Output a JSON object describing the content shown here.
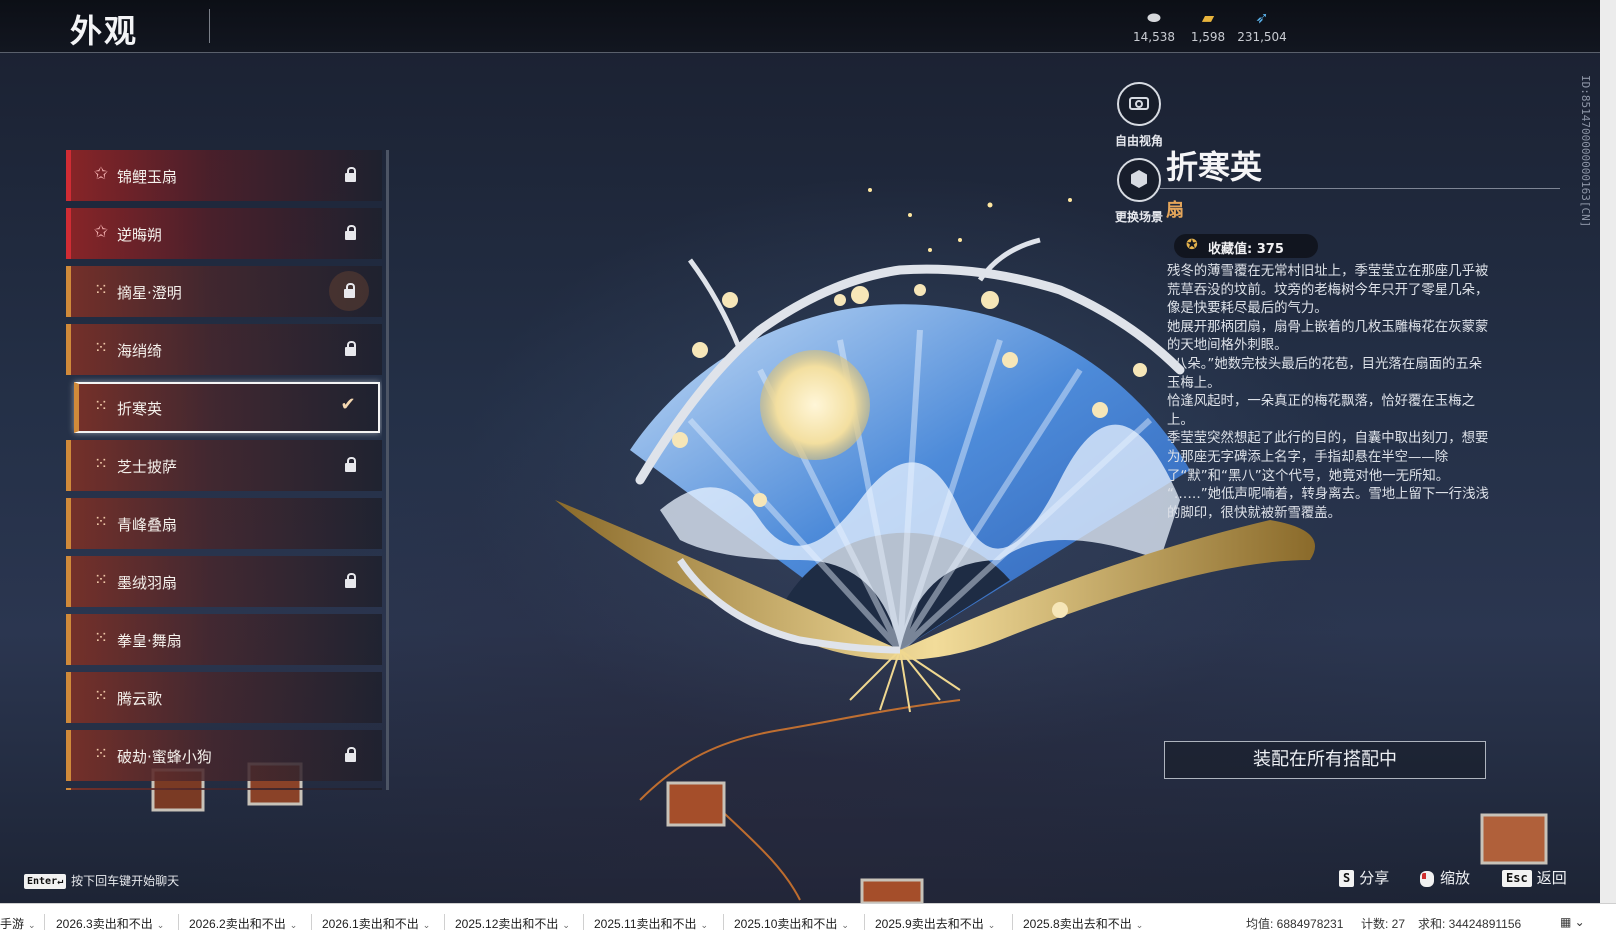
{
  "header": {
    "title": "外观",
    "currencies": [
      {
        "icon": "silver-ingot-icon",
        "value": "14,538"
      },
      {
        "icon": "gold-ticket-icon",
        "value": "1,598"
      },
      {
        "icon": "feather-token-icon",
        "value": "231,504"
      }
    ],
    "player_id": "ID:8514700000000163[CN]"
  },
  "skins": [
    {
      "name": "锦鲤玉扇",
      "rarity": "red",
      "locked": true
    },
    {
      "name": "逆晦朔",
      "rarity": "red",
      "locked": true
    },
    {
      "name": "摘星·澄明",
      "rarity": "orange",
      "locked": true
    },
    {
      "name": "海绡绮",
      "rarity": "orange",
      "locked": true
    },
    {
      "name": "折寒英",
      "rarity": "orange",
      "locked": false,
      "selected": true
    },
    {
      "name": "芝士披萨",
      "rarity": "orange",
      "locked": true
    },
    {
      "name": "青峰叠扇",
      "rarity": "orange",
      "locked": false
    },
    {
      "name": "墨绒羽扇",
      "rarity": "orange",
      "locked": true
    },
    {
      "name": "拳皇·舞扇",
      "rarity": "orange",
      "locked": false
    },
    {
      "name": "腾云歌",
      "rarity": "orange",
      "locked": false
    },
    {
      "name": "破劫·蜜蜂小狗",
      "rarity": "orange",
      "locked": true
    }
  ],
  "camera": {
    "free_view": "自由视角",
    "change_scene": "更换场景"
  },
  "detail": {
    "name": "折寒英",
    "type": "扇",
    "collect_label": "收藏值: 375",
    "lore": [
      "残冬的薄雪覆在无常村旧址上，季莹莹立在那座几乎被荒草吞没的坟前。坟旁的老梅树今年只开了零星几朵，像是快要耗尽最后的气力。",
      "她展开那柄团扇，扇骨上嵌着的几枚玉雕梅花在灰蒙蒙的天地间格外刺眼。",
      "“八朵。”她数完枝头最后的花苞，目光落在扇面的五朵玉梅上。",
      "恰逢风起时，一朵真正的梅花飘落，恰好覆在玉梅之上。",
      "季莹莹突然想起了此行的目的，自囊中取出刻刀，想要为那座无字碑添上名字，手指却悬在半空——除了“默”和“黑八”这个代号，她竟对他一无所知。",
      "“……”她低声呢喃着，转身离去。雪地上留下一行浅浅的脚印，很快就被新雪覆盖。"
    ],
    "equip_button": "装配在所有搭配中"
  },
  "hints": {
    "chat_key": "Enter↵",
    "chat_text": "按下回车键开始聊天",
    "share_key": "S",
    "share_text": "分享",
    "zoom_text": "缩放",
    "back_key": "Esc",
    "back_text": "返回"
  },
  "sheet": {
    "tabs": [
      "手游",
      "2026.3卖出和不出",
      "2026.2卖出和不出",
      "2026.1卖出和不出",
      "2025.12卖出和不出",
      "2025.11卖出和不出",
      "2025.10卖出和不出",
      "2025.9卖出去和不出",
      "2025.8卖出去和不出"
    ],
    "average": "均值: 6884978231",
    "count": "计数: 27",
    "sum": "求和: 34424891156"
  }
}
